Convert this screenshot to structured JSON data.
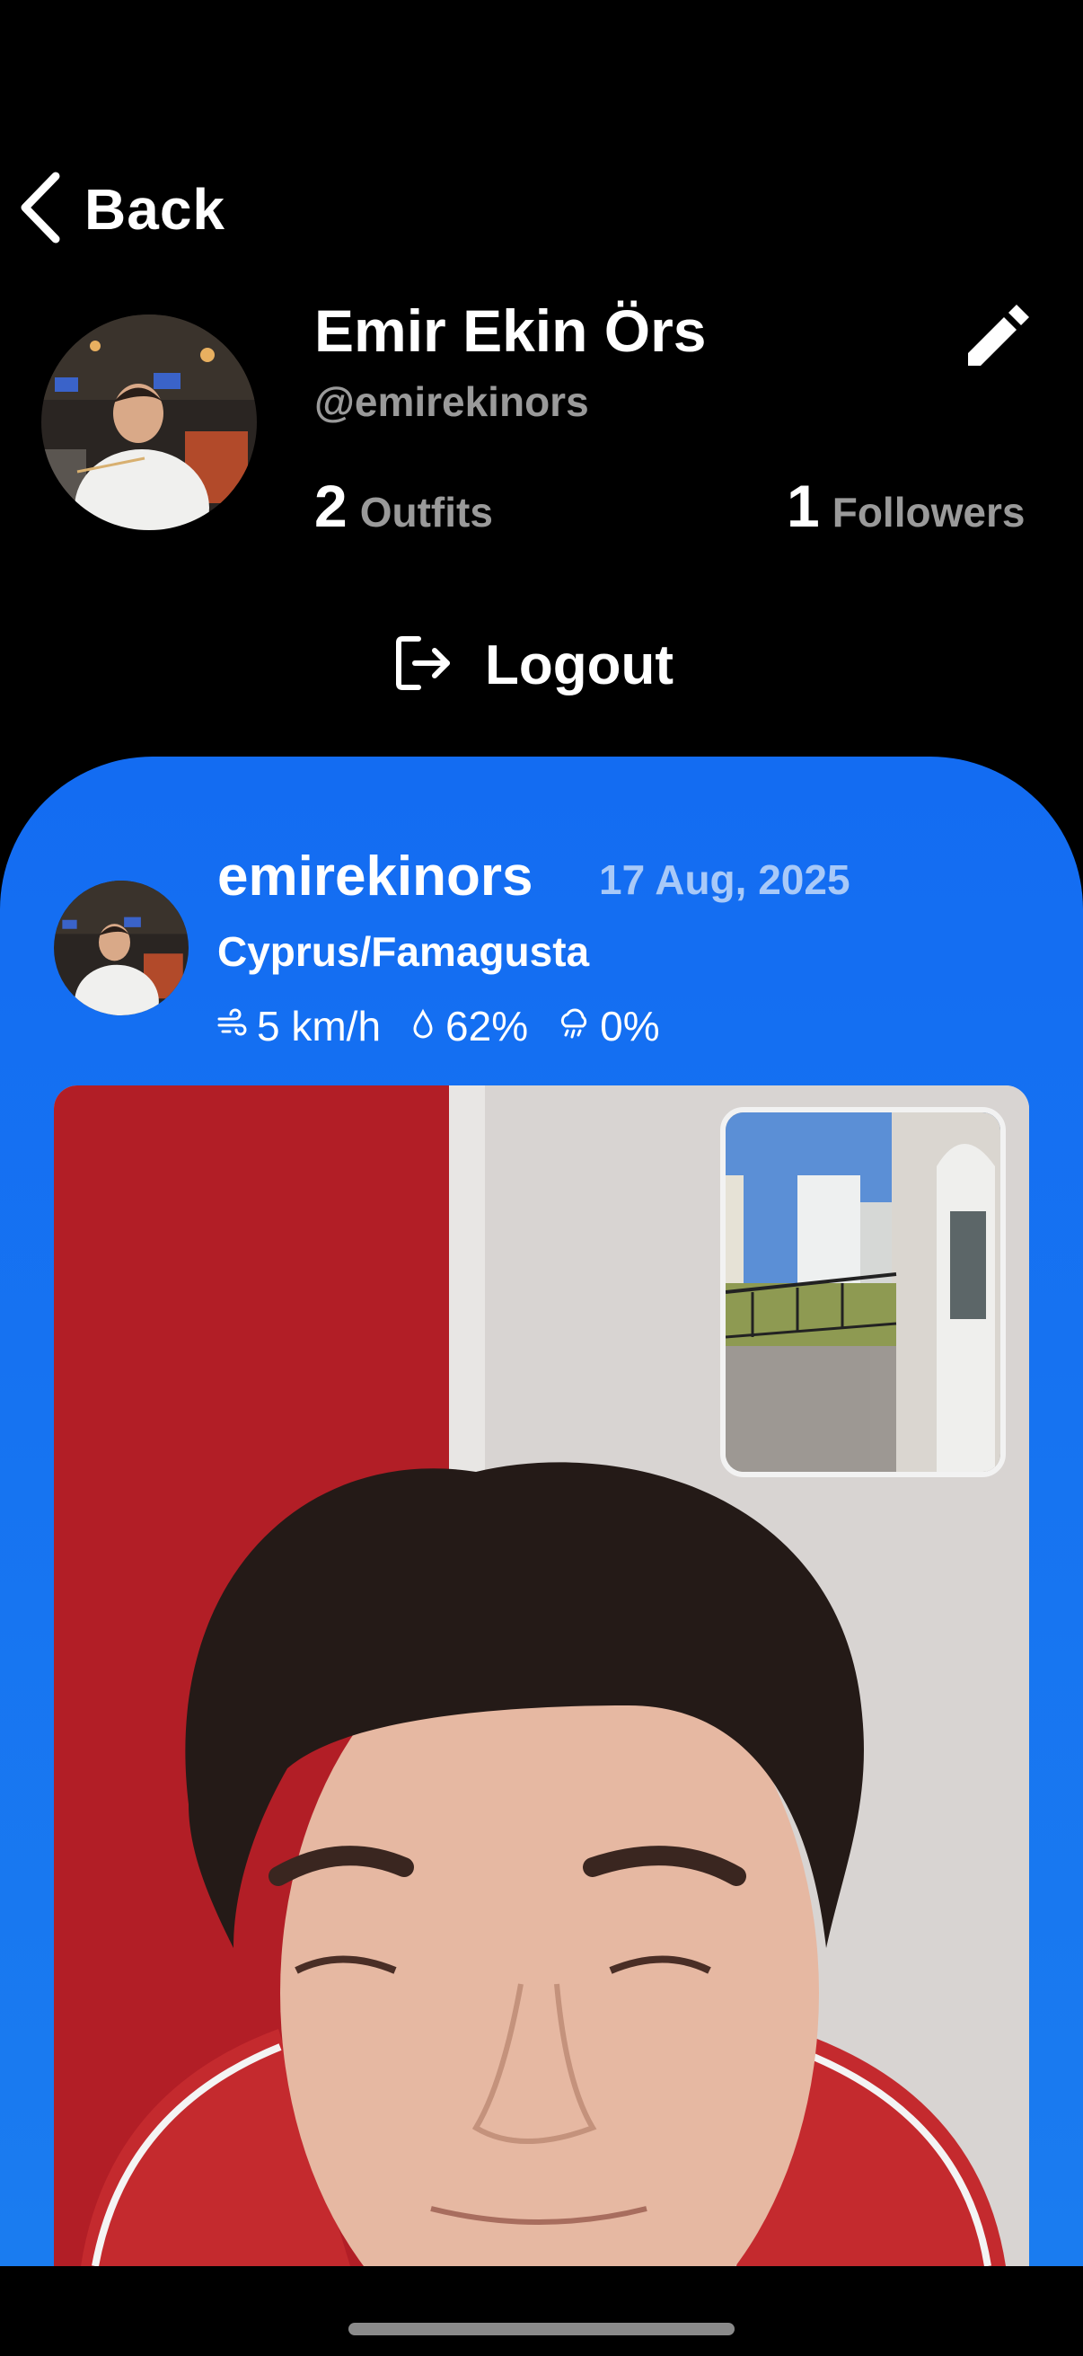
{
  "nav": {
    "back_label": "Back"
  },
  "profile": {
    "name": "Emir Ekin Örs",
    "handle": "@emirekinors",
    "outfits_count": "2",
    "outfits_label": "Outfits",
    "followers_count": "1",
    "followers_label": "Followers",
    "logout_label": "Logout"
  },
  "post": {
    "username": "emirekinors",
    "date": "17 Aug, 2025",
    "location": "Cyprus/Famagusta",
    "wind": "5 km/h",
    "humidity": "62%",
    "precipitation": "0%"
  },
  "colors": {
    "background": "#000000",
    "card_blue": "#136cf2",
    "secondary_text": "#9a9a9a",
    "date_text": "#a8c9f8"
  },
  "icons": [
    "chevron-left-icon",
    "pencil-icon",
    "logout-icon",
    "wind-icon",
    "droplet-icon",
    "rain-cloud-icon"
  ]
}
